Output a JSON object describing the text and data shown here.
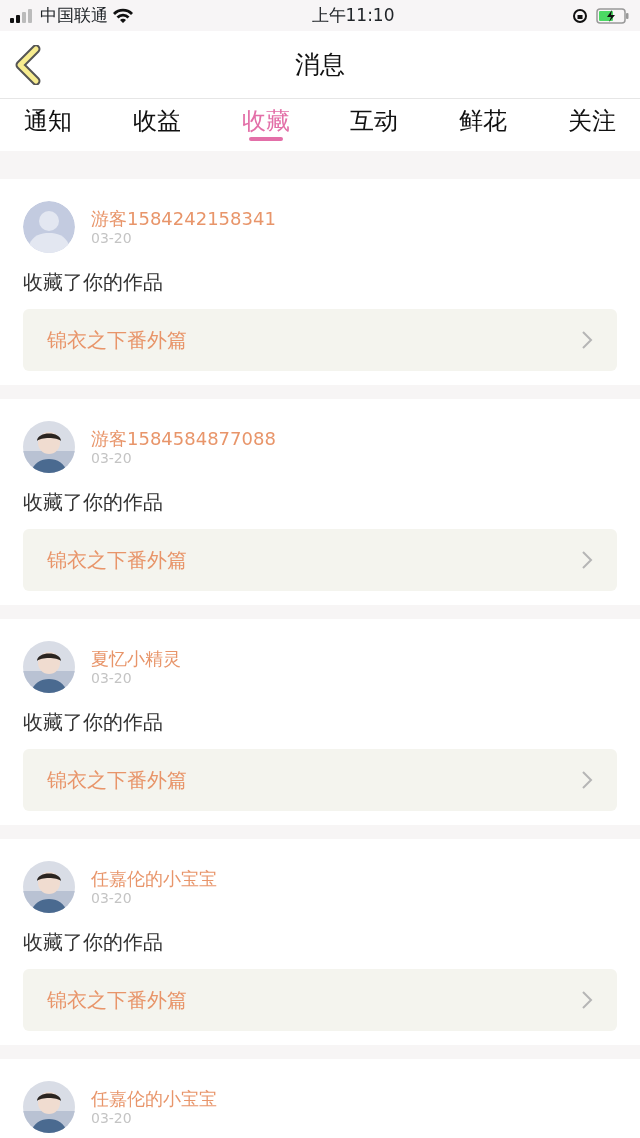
{
  "status_bar": {
    "carrier": "中国联通",
    "time": "上午11:10"
  },
  "header": {
    "title": "消息"
  },
  "tabs": [
    {
      "label": "通知",
      "selected": false
    },
    {
      "label": "收益",
      "selected": false
    },
    {
      "label": "收藏",
      "selected": true
    },
    {
      "label": "互动",
      "selected": false
    },
    {
      "label": "鲜花",
      "selected": false
    },
    {
      "label": "关注",
      "selected": false
    }
  ],
  "messages": [
    {
      "avatar": {
        "kind": "default"
      },
      "user": "游客1584242158341",
      "date": "03-20",
      "action": "收藏了你的作品",
      "work": "锦衣之下番外篇"
    },
    {
      "user": "游客1584584877088",
      "date": "03-20",
      "action": "收藏了你的作品",
      "work": "锦衣之下番外篇"
    },
    {
      "user": "夏忆小精灵",
      "date": "03-20",
      "action": "收藏了你的作品",
      "work": "锦衣之下番外篇"
    },
    {
      "user": "任嘉伦的小宝宝",
      "date": "03-20",
      "action": "收藏了你的作品",
      "work": "锦衣之下番外篇"
    },
    {
      "user": "任嘉伦的小宝宝",
      "date": "03-20"
    }
  ]
}
